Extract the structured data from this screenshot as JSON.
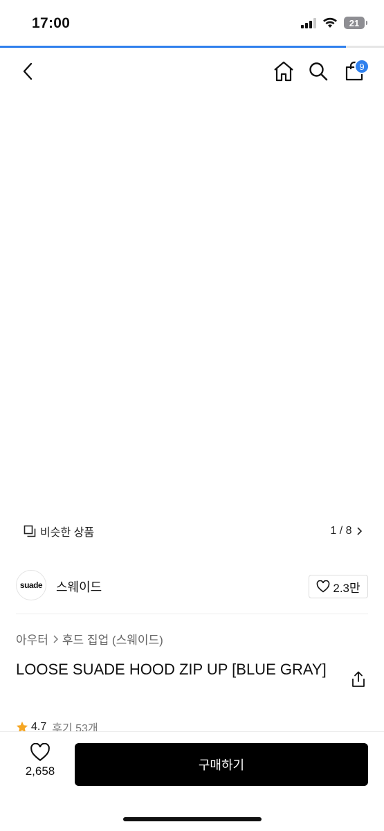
{
  "status_bar": {
    "time": "17:00",
    "battery": "21"
  },
  "browse_progress": 0.9,
  "nav": {
    "cart_badge": "9"
  },
  "gallery": {
    "similar_label": "비슷한 상품",
    "page": "1 / 8"
  },
  "brand": {
    "logo_text": "suade",
    "name": "스웨이드",
    "likes": "2.3만"
  },
  "breadcrumb": {
    "category": "아우터",
    "subcategory": "후드 집업 (스웨이드)"
  },
  "product": {
    "title": "LOOSE SUADE HOOD ZIP UP [BLUE GRAY]",
    "rating": "4.7",
    "reviews": "후기 53개"
  },
  "bottom": {
    "wish_count": "2,658",
    "buy_label": "구매하기"
  },
  "colors": {
    "accent": "#2f80ed",
    "hoodie": "#7d848a",
    "buy_button": "#000000"
  }
}
